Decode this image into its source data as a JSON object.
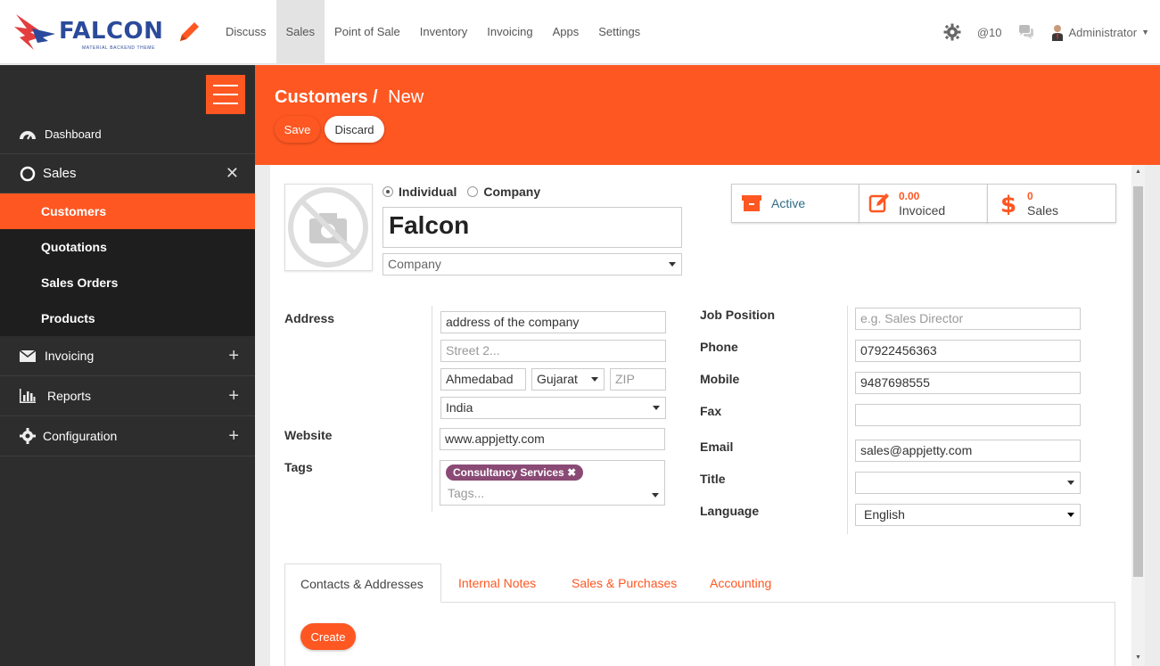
{
  "brand": {
    "name": "FALCON",
    "subtitle": "MATERIAL BACKEND THEME",
    "accent": "#fe5722",
    "sidebar_bg": "#2d2d2d",
    "logo_color": "#2b4a9b"
  },
  "topmenu": {
    "items": [
      "Discuss",
      "Sales",
      "Point of Sale",
      "Inventory",
      "Invoicing",
      "Apps",
      "Settings"
    ],
    "active": "Sales"
  },
  "topright": {
    "notifications": "@10",
    "user": "Administrator"
  },
  "sidebar": {
    "dashboard": "Dashboard",
    "sales": "Sales",
    "sales_children": [
      "Customers",
      "Quotations",
      "Sales Orders",
      "Products"
    ],
    "active_child": "Customers",
    "invoicing": "Invoicing",
    "reports": "Reports",
    "configuration": "Configuration"
  },
  "header": {
    "breadcrumb_parent": "Customers /",
    "breadcrumb_current": "New",
    "save": "Save",
    "discard": "Discard"
  },
  "form": {
    "type_options": [
      "Individual",
      "Company"
    ],
    "type_selected": "Individual",
    "name": "Falcon",
    "company_placeholder": "Company",
    "stats": {
      "active": "Active",
      "invoiced_value": "0.00",
      "invoiced_label": "Invoiced",
      "sales_value": "0",
      "sales_label": "Sales"
    },
    "address_label": "Address",
    "street": "address of the company",
    "street2_placeholder": "Street 2...",
    "city": "Ahmedabad",
    "state": "Gujarat",
    "zip_placeholder": "ZIP",
    "country": "India",
    "website_label": "Website",
    "website": "www.appjetty.com",
    "tags_label": "Tags",
    "tag": "Consultancy Services",
    "tags_placeholder": "Tags...",
    "job_label": "Job Position",
    "job_placeholder": "e.g. Sales Director",
    "phone_label": "Phone",
    "phone": "07922456363",
    "mobile_label": "Mobile",
    "mobile": "9487698555",
    "fax_label": "Fax",
    "fax": "",
    "email_label": "Email",
    "email": "sales@appjetty.com",
    "title_label": "Title",
    "title": "",
    "language_label": "Language",
    "language": "English"
  },
  "tabs": {
    "items": [
      "Contacts & Addresses",
      "Internal Notes",
      "Sales & Purchases",
      "Accounting"
    ],
    "active": "Contacts & Addresses",
    "create": "Create"
  }
}
